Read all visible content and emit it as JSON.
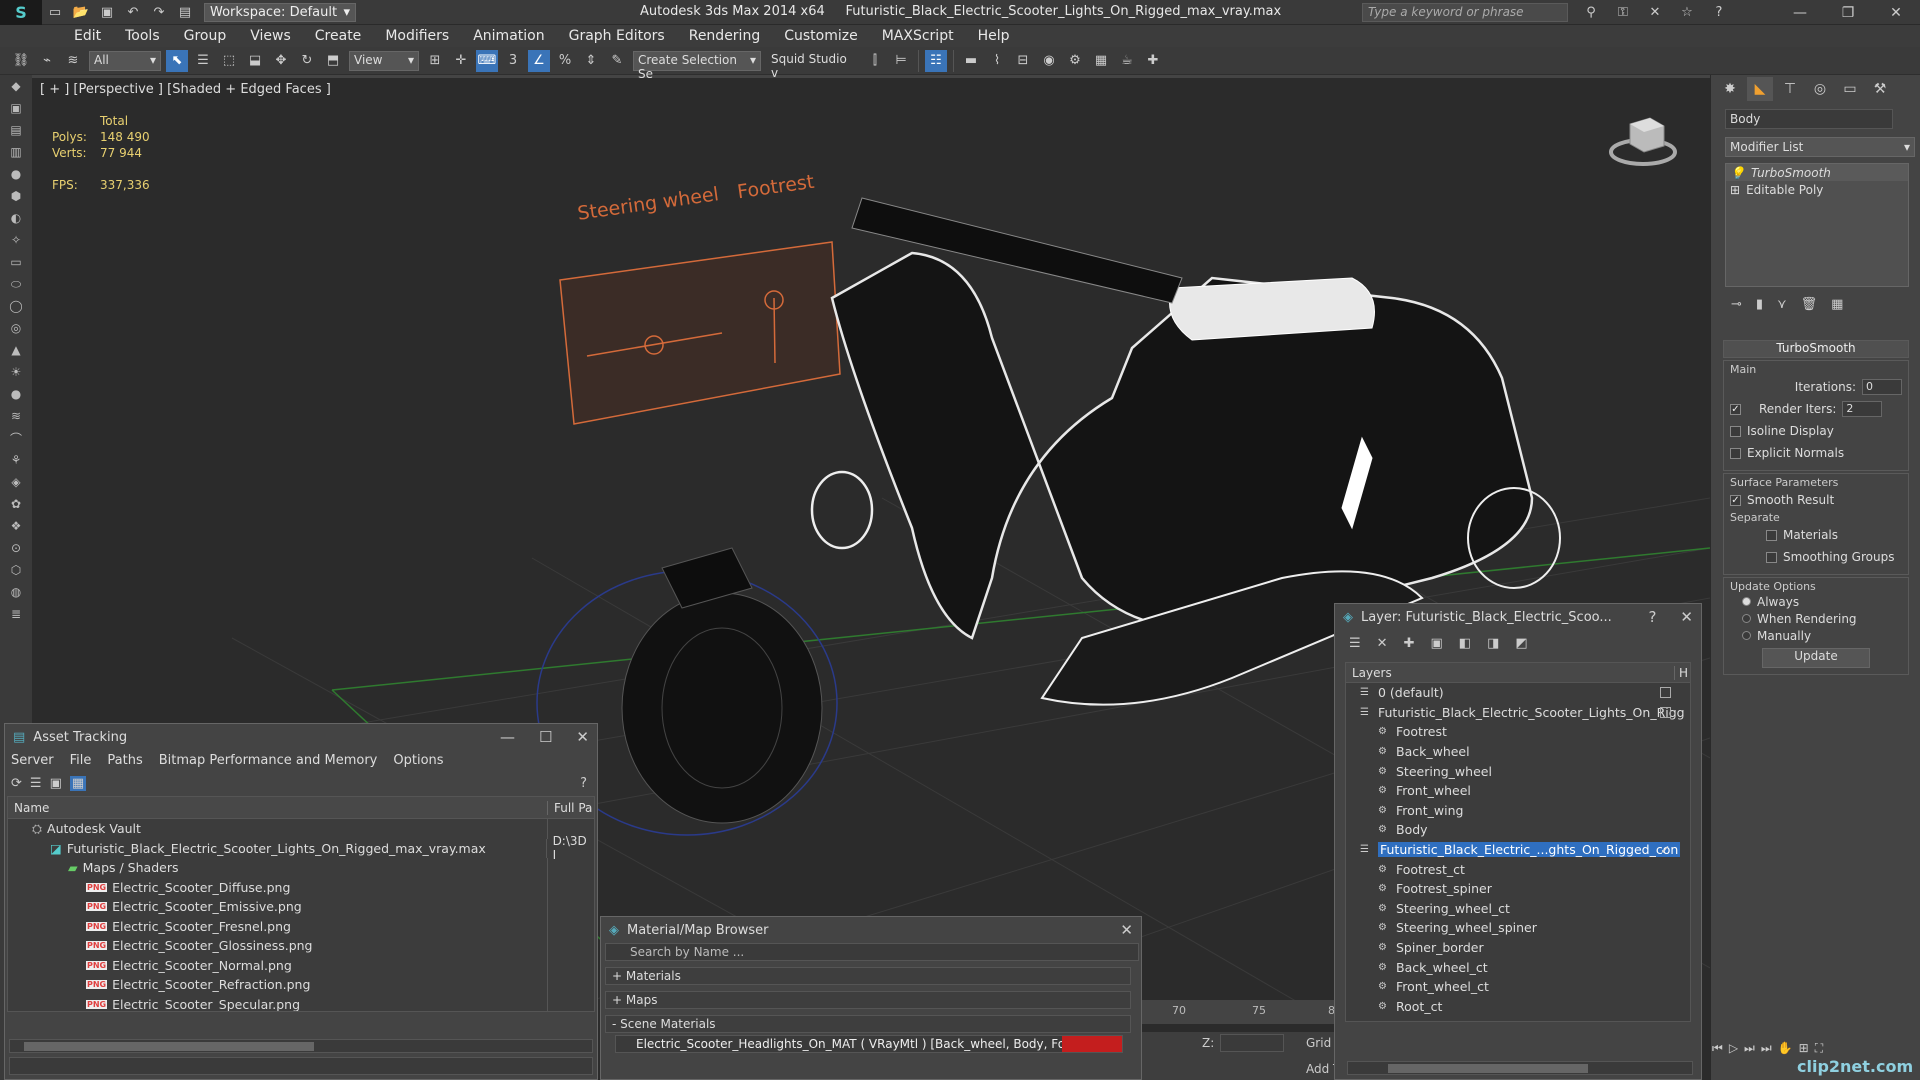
{
  "titlebar": {
    "workspace": "Workspace: Default",
    "app_name": "Autodesk 3ds Max  2014 x64",
    "file_name": "Futuristic_Black_Electric_Scooter_Lights_On_Rigged_max_vray.max",
    "search_placeholder": "Type a keyword or phrase"
  },
  "menu": [
    "Edit",
    "Tools",
    "Group",
    "Views",
    "Create",
    "Modifiers",
    "Animation",
    "Graph Editors",
    "Rendering",
    "Customize",
    "MAXScript",
    "Help"
  ],
  "toolbar": {
    "filter": "All",
    "ref_coord": "View",
    "selection_set": "Create Selection Se",
    "squid": "Squid Studio v"
  },
  "viewport": {
    "label": "[ + ] [Perspective ] [Shaded + Edged Faces ]",
    "stats": {
      "total_label": "Total",
      "polys_label": "Polys:",
      "polys": "148 490",
      "verts_label": "Verts:",
      "verts": "77 944",
      "fps_label": "FPS:",
      "fps": "337,336"
    },
    "rig_panel": {
      "steering_label": "Steering wheel",
      "footrest_label": "Footrest"
    }
  },
  "command_panel": {
    "object_name": "Body",
    "modifier_list": "Modifier List",
    "stack": [
      "TurboSmooth",
      "Editable Poly"
    ],
    "turbosmooth": {
      "title": "TurboSmooth",
      "main_label": "Main",
      "iterations_label": "Iterations:",
      "iterations": "0",
      "render_iters_label": "Render Iters:",
      "render_iters": "2",
      "isoline": "Isoline Display",
      "explicit_normals": "Explicit Normals",
      "surface_params": "Surface Parameters",
      "smooth_result": "Smooth Result",
      "separate": "Separate",
      "materials": "Materials",
      "smoothing_groups": "Smoothing Groups",
      "update_options": "Update Options",
      "always": "Always",
      "when_rendering": "When Rendering",
      "manually": "Manually",
      "update_btn": "Update"
    }
  },
  "asset_tracking": {
    "title": "Asset Tracking",
    "menu": [
      "Server",
      "File",
      "Paths",
      "Bitmap Performance and Memory",
      "Options"
    ],
    "col_name": "Name",
    "col_path": "Full Pa",
    "rows": [
      {
        "name": "Autodesk Vault",
        "path": "",
        "level": 1,
        "kind": "vault"
      },
      {
        "name": "Futuristic_Black_Electric_Scooter_Lights_On_Rigged_max_vray.max",
        "path": "D:\\3D I",
        "level": 2,
        "kind": "max"
      },
      {
        "name": "Maps / Shaders",
        "path": "",
        "level": 3,
        "kind": "folder"
      },
      {
        "name": "Electric_Scooter_Diffuse.png",
        "path": "",
        "level": 4,
        "kind": "png"
      },
      {
        "name": "Electric_Scooter_Emissive.png",
        "path": "",
        "level": 4,
        "kind": "png"
      },
      {
        "name": "Electric_Scooter_Fresnel.png",
        "path": "",
        "level": 4,
        "kind": "png"
      },
      {
        "name": "Electric_Scooter_Glossiness.png",
        "path": "",
        "level": 4,
        "kind": "png"
      },
      {
        "name": "Electric_Scooter_Normal.png",
        "path": "",
        "level": 4,
        "kind": "png"
      },
      {
        "name": "Electric_Scooter_Refraction.png",
        "path": "",
        "level": 4,
        "kind": "png"
      },
      {
        "name": "Electric_Scooter_Specular.png",
        "path": "",
        "level": 4,
        "kind": "png"
      }
    ],
    "png_badge": "PNG"
  },
  "material_browser": {
    "title": "Material/Map Browser",
    "search_placeholder": "Search by Name ...",
    "groups": [
      "+ Materials",
      "+ Maps",
      "- Scene Materials"
    ],
    "entry": "Electric_Scooter_Headlights_On_MAT ( VRayMtl ) [Back_wheel, Body, Footrest,..."
  },
  "timeline": {
    "t70": "70",
    "t75": "75",
    "t8": "8",
    "z_label": "Z:",
    "grid_label": "Grid",
    "add_label": "Add T"
  },
  "layer_window": {
    "title": "Layer: Futuristic_Black_Electric_Scoo...",
    "help": "?",
    "col_layers": "Layers",
    "col_h": "H",
    "rows": [
      {
        "name": "0 (default)",
        "level": 0,
        "kind": "layer",
        "checkbox": true
      },
      {
        "name": "Futuristic_Black_Electric_Scooter_Lights_On_Rigg",
        "level": 0,
        "kind": "layer",
        "checkbox": true
      },
      {
        "name": "Footrest",
        "level": 1,
        "kind": "object"
      },
      {
        "name": "Back_wheel",
        "level": 1,
        "kind": "object"
      },
      {
        "name": "Steering_wheel",
        "level": 1,
        "kind": "object"
      },
      {
        "name": "Front_wheel",
        "level": 1,
        "kind": "object"
      },
      {
        "name": "Front_wing",
        "level": 1,
        "kind": "object"
      },
      {
        "name": "Body",
        "level": 1,
        "kind": "object"
      },
      {
        "name": "Futuristic_Black_Electric_...ghts_On_Rigged_con",
        "level": 0,
        "kind": "layer",
        "selected": true
      },
      {
        "name": "Footrest_ct",
        "level": 1,
        "kind": "object"
      },
      {
        "name": "Footrest_spiner",
        "level": 1,
        "kind": "object"
      },
      {
        "name": "Steering_wheel_ct",
        "level": 1,
        "kind": "object"
      },
      {
        "name": "Steering_wheel_spiner",
        "level": 1,
        "kind": "object"
      },
      {
        "name": "Spiner_border",
        "level": 1,
        "kind": "object"
      },
      {
        "name": "Back_wheel_ct",
        "level": 1,
        "kind": "object"
      },
      {
        "name": "Front_wheel_ct",
        "level": 1,
        "kind": "object"
      },
      {
        "name": "Root_ct",
        "level": 1,
        "kind": "object"
      }
    ]
  },
  "watermark": "clip2net.com"
}
